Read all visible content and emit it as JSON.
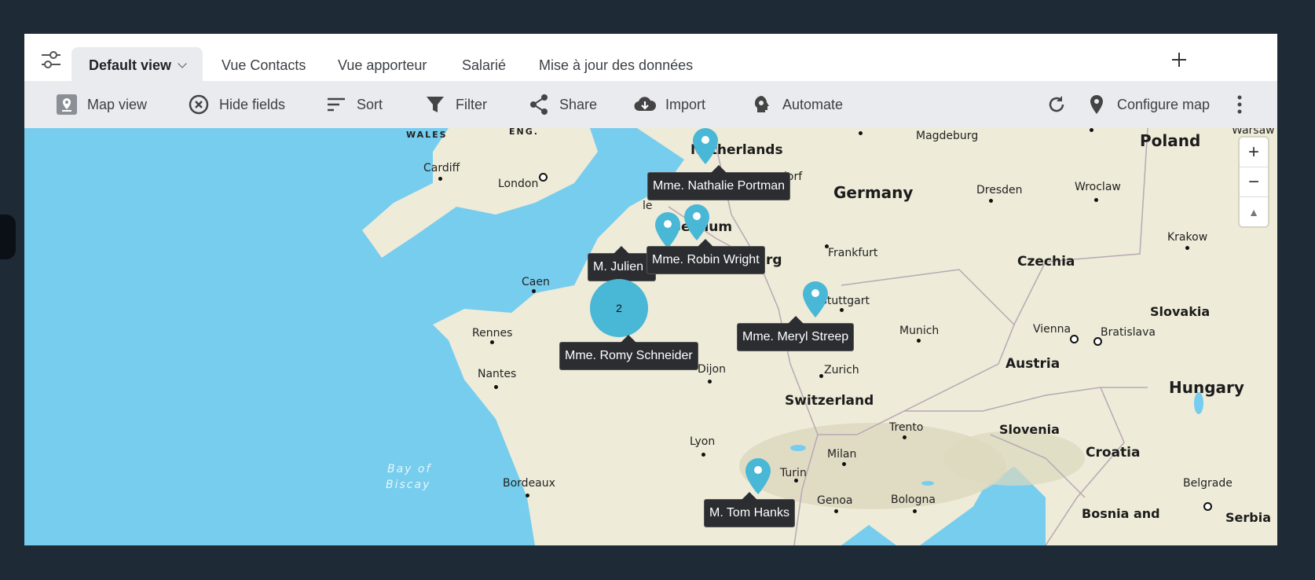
{
  "tabs": {
    "settings_icon": "sliders-icon",
    "items": [
      {
        "label": "Default view",
        "active": true
      },
      {
        "label": "Vue Contacts"
      },
      {
        "label": "Vue apporteur"
      },
      {
        "label": "Salarié"
      },
      {
        "label": "Mise à jour des données"
      }
    ],
    "add_icon": "plus-icon"
  },
  "toolbar": {
    "map_view": "Map view",
    "hide_fields": "Hide fields",
    "sort": "Sort",
    "filter": "Filter",
    "share": "Share",
    "import": "Import",
    "automate": "Automate",
    "configure_map": "Configure map",
    "accent_color": "#3b3f44"
  },
  "map": {
    "countries": {
      "poland": "Poland",
      "germany": "Germany",
      "netherlands": "Netherlands",
      "belgium": "Belgium",
      "czechia": "Czechia",
      "slovakia": "Slovakia",
      "austria": "Austria",
      "hungary": "Hungary",
      "switzerland": "Switzerland",
      "slovenia": "Slovenia",
      "croatia": "Croatia",
      "bosnia": "Bosnia and",
      "serbia": "Serbia",
      "luxembourg_partial": "bourg"
    },
    "regions": {
      "wales": "WALES",
      "eng": "ENG."
    },
    "sea": {
      "line1": "Bay of",
      "line2": "Biscay"
    },
    "cities": {
      "cardiff": "Cardiff",
      "london": "London",
      "caen": "Caen",
      "rennes": "Rennes",
      "nantes": "Nantes",
      "bordeaux": "Bordeaux",
      "lyon": "Lyon",
      "dijon": "Dijon",
      "magdeburg": "Magdeburg",
      "dresden": "Dresden",
      "wroclaw": "Wroclaw",
      "krakow": "Krakow",
      "frankfurt": "Frankfurt",
      "stuttgart": "Stuttgart",
      "munich": "Munich",
      "vienna": "Vienna",
      "bratislava": "Bratislava",
      "zurich": "Zurich",
      "trento": "Trento",
      "milan": "Milan",
      "turin": "Turin",
      "genoa": "Genoa",
      "bologna": "Bologna",
      "belgrade": "Belgrade",
      "warsaw_partial": "Warsaw",
      "dorf_partial": "dorf",
      "lille_partial": "le"
    },
    "markers": [
      {
        "label": "Mme. Nathalie Portman"
      },
      {
        "label": "Mme. Robin Wright"
      },
      {
        "label": "M. Julien I"
      },
      {
        "label": "Mme. Meryl Streep"
      },
      {
        "label": "Mme. Romy Schneider"
      },
      {
        "label": "M. Tom Hanks"
      }
    ],
    "cluster_count": "2",
    "marker_color": "#49b7d6",
    "zoom": {
      "in": "+",
      "out": "−",
      "compass": "▲"
    }
  }
}
